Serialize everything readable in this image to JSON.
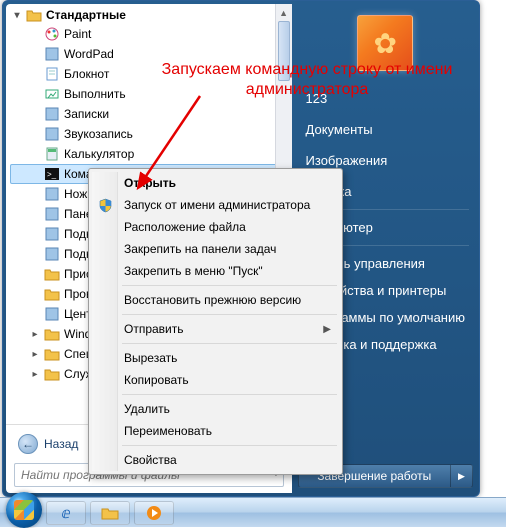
{
  "annotation": {
    "text": "Запускаем командную строку от имени администратора"
  },
  "tree": {
    "header": "Стандартные",
    "items": [
      {
        "icon": "paint",
        "label": "Paint"
      },
      {
        "icon": "wordpad",
        "label": "WordPad"
      },
      {
        "icon": "notepad",
        "label": "Блокнот"
      },
      {
        "icon": "run",
        "label": "Выполнить"
      },
      {
        "icon": "sticky",
        "label": "Записки"
      },
      {
        "icon": "sound",
        "label": "Звукозапись"
      },
      {
        "icon": "calc",
        "label": "Калькулятор"
      },
      {
        "icon": "cmd",
        "label": "Кома",
        "selected": true
      },
      {
        "icon": "snip",
        "label": "Ножн"
      },
      {
        "icon": "tablet",
        "label": "Пане"
      },
      {
        "icon": "rdp",
        "label": "Подк"
      },
      {
        "icon": "proj",
        "label": "Подк"
      },
      {
        "icon": "explorer",
        "label": "Прис"
      },
      {
        "icon": "explorer",
        "label": "Пров"
      },
      {
        "icon": "mobility",
        "label": "Цент"
      },
      {
        "icon": "folder",
        "label": "Wind",
        "expandable": true
      },
      {
        "icon": "folder",
        "label": "Спец",
        "expandable": true
      },
      {
        "icon": "folder",
        "label": "Служ",
        "expandable": true
      }
    ]
  },
  "back_label": "Назад",
  "search_placeholder": "Найти программы и файлы",
  "right": {
    "username": "123",
    "links": [
      "Документы",
      "Изображения",
      "Музыка",
      "Компьютер",
      "Панель управления",
      "Устройства и принтеры",
      "Программы по умолчанию",
      "Справка и поддержка"
    ],
    "shutdown": "Завершение работы"
  },
  "context_menu": {
    "items": [
      {
        "label": "Открыть",
        "bold": true
      },
      {
        "label": "Запуск от имени администратора",
        "shield": true
      },
      {
        "label": "Расположение файла"
      },
      {
        "label": "Закрепить на панели задач"
      },
      {
        "label": "Закрепить в меню \"Пуск\""
      },
      {
        "sep": true
      },
      {
        "label": "Восстановить прежнюю версию"
      },
      {
        "sep": true
      },
      {
        "label": "Отправить",
        "submenu": true
      },
      {
        "sep": true
      },
      {
        "label": "Вырезать"
      },
      {
        "label": "Копировать"
      },
      {
        "sep": true
      },
      {
        "label": "Удалить"
      },
      {
        "label": "Переименовать"
      },
      {
        "sep": true
      },
      {
        "label": "Свойства"
      }
    ]
  }
}
